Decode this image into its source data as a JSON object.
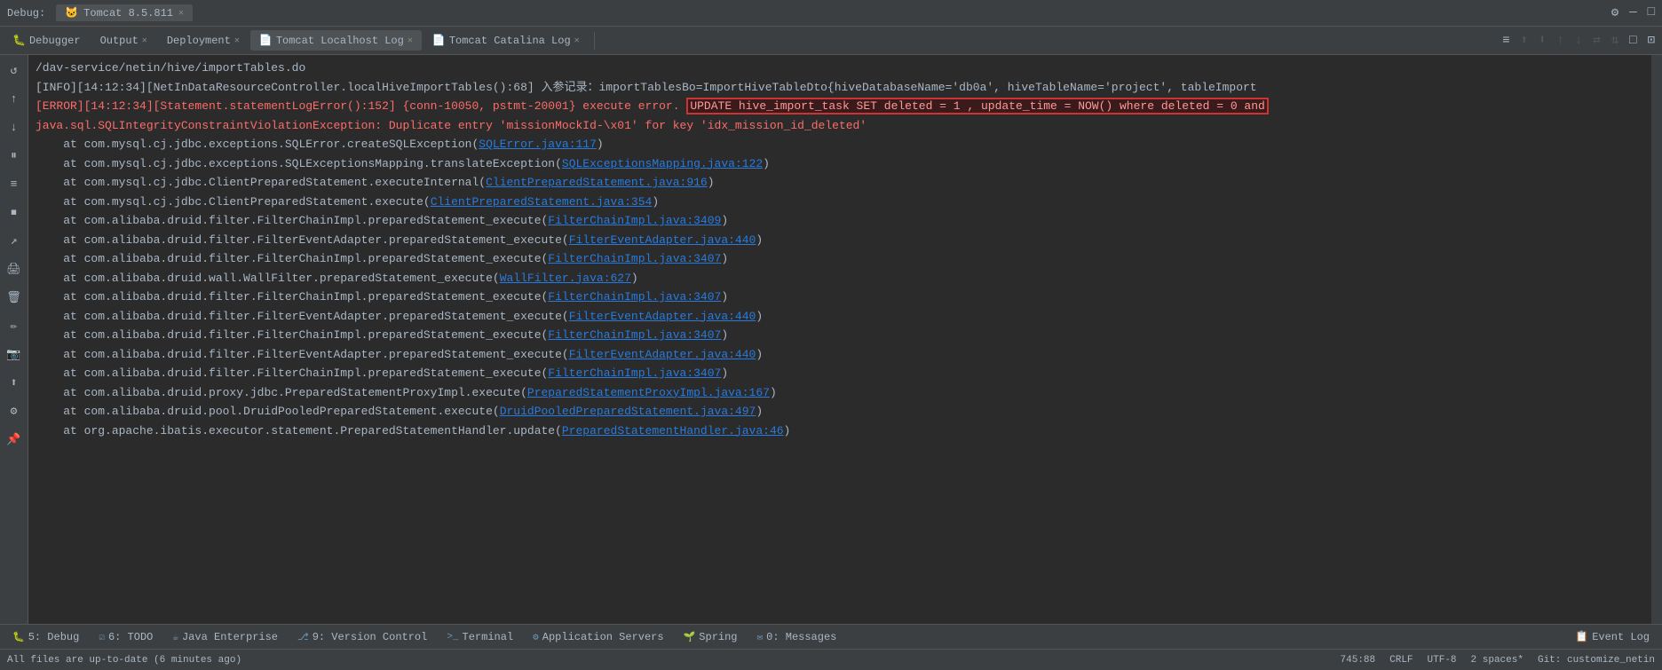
{
  "titleBar": {
    "debugLabel": "Debug:",
    "tomcatTab": "Tomcat 8.5.811",
    "settingsIcon": "⚙",
    "minIcon": "—",
    "maxIcon": "□"
  },
  "toolbar": {
    "tabs": [
      {
        "label": "Debugger",
        "icon": "🐛",
        "active": false,
        "closable": false
      },
      {
        "label": "Output",
        "icon": "",
        "active": false,
        "closable": false
      },
      {
        "label": "Deployment",
        "icon": "",
        "active": false,
        "closable": false
      },
      {
        "label": "Tomcat Localhost Log",
        "icon": "",
        "active": false,
        "closable": true
      },
      {
        "label": "Tomcat Catalina Log",
        "icon": "",
        "active": false,
        "closable": true
      }
    ],
    "icons": [
      "≡",
      "↑",
      "↓",
      "↑",
      "↓",
      "⇄",
      "⇅",
      "□",
      "⊡"
    ]
  },
  "sidebarIcons": [
    "↺",
    "↑",
    "↓",
    "⏸",
    "≡",
    "⏹",
    "↗",
    "🖨",
    "🗑",
    "✏",
    "📷",
    "⬆",
    "⚙",
    "📌"
  ],
  "logLines": [
    {
      "type": "path",
      "text": "/dav-service/netin/hive/importTables.do"
    },
    {
      "type": "info",
      "text": "[INFO][14:12:34][NetInDataResourceController.localHiveImportTables():68] 入参记录：importTablesBo=ImportHiveTableDto{hiveDatabaseName='db0a', hiveTableName='project', tableImport"
    },
    {
      "type": "error_highlight",
      "text": "[ERROR][14:12:34][Statement.statementLogError():152] {conn-10050, pstmt-20001} execute error.",
      "highlight": "UPDATE hive_import_task SET deleted = 1 , update_time = NOW() where deleted = 0 and"
    },
    {
      "type": "error",
      "text": "java.sql.SQLIntegrityConstraintViolationException: Duplicate entry 'missionMockId-\\x01' for key 'idx_mission_id_deleted'"
    },
    {
      "type": "stack",
      "text": "    at com.mysql.cj.jdbc.exceptions.SQLError.createSQLException(SQLError.java:117)"
    },
    {
      "type": "stack",
      "text": "    at com.mysql.cj.jdbc.exceptions.SQLExceptionsMapping.translateException(SQLExceptionsMapping.java:122)"
    },
    {
      "type": "stack",
      "text": "    at com.mysql.cj.jdbc.ClientPreparedStatement.executeInternal(ClientPreparedStatement.java:916)"
    },
    {
      "type": "stack",
      "text": "    at com.mysql.cj.jdbc.ClientPreparedStatement.execute(ClientPreparedStatement.java:354)"
    },
    {
      "type": "stack",
      "text": "    at com.alibaba.druid.filter.FilterChainImpl.preparedStatement_execute(FilterChainImpl.java:3409)"
    },
    {
      "type": "stack",
      "text": "    at com.alibaba.druid.filter.FilterEventAdapter.preparedStatement_execute(FilterEventAdapter.java:440)"
    },
    {
      "type": "stack",
      "text": "    at com.alibaba.druid.filter.FilterChainImpl.preparedStatement_execute(FilterChainImpl.java:3407)"
    },
    {
      "type": "stack",
      "text": "    at com.alibaba.druid.wall.WallFilter.preparedStatement_execute(WallFilter.java:627)"
    },
    {
      "type": "stack",
      "text": "    at com.alibaba.druid.filter.FilterChainImpl.preparedStatement_execute(FilterChainImpl.java:3407)"
    },
    {
      "type": "stack",
      "text": "    at com.alibaba.druid.filter.FilterEventAdapter.preparedStatement_execute(FilterEventAdapter.java:440)"
    },
    {
      "type": "stack",
      "text": "    at com.alibaba.druid.filter.FilterChainImpl.preparedStatement_execute(FilterChainImpl.java:3407)"
    },
    {
      "type": "stack",
      "text": "    at com.alibaba.druid.filter.FilterEventAdapter.preparedStatement_execute(FilterEventAdapter.java:440)"
    },
    {
      "type": "stack",
      "text": "    at com.alibaba.druid.filter.FilterChainImpl.preparedStatement_execute(FilterChainImpl.java:3407)"
    },
    {
      "type": "stack",
      "text": "    at com.alibaba.druid.proxy.jdbc.PreparedStatementProxyImpl.execute(PreparedStatementProxyImpl.java:167)"
    },
    {
      "type": "stack",
      "text": "    at com.alibaba.druid.pool.DruidPooledPreparedStatement.execute(DruidPooledPreparedStatement.java:497)"
    },
    {
      "type": "stack",
      "text": "    at org.apache.ibatis.executor.statement.PreparedStatementHandler.update(PreparedStatementHandler.java:46)"
    }
  ],
  "highlightedSQL": "UPDATE hive_import_task SET deleted = 1 , update_time = NOW() where deleted = 0 and",
  "highlightedSQLEnd": "and",
  "statusBar": {
    "message": "All files are up-to-date (6 minutes ago)",
    "position": "745:88",
    "lineEnding": "CRLF",
    "encoding": "UTF-8",
    "indentation": "2 spaces*",
    "vcs": "Git: customize_netin"
  },
  "bottomTabs": [
    {
      "label": "5: Debug",
      "icon": "🐛",
      "active": false
    },
    {
      "label": "6: TODO",
      "icon": "☑",
      "active": false
    },
    {
      "label": "Java Enterprise",
      "icon": "☕",
      "active": false
    },
    {
      "label": "9: Version Control",
      "icon": "⎇",
      "active": false
    },
    {
      "label": "Terminal",
      "icon": ">_",
      "active": false
    },
    {
      "label": "Application Servers",
      "icon": "⚙",
      "active": false
    },
    {
      "label": "Spring",
      "icon": "🌱",
      "active": false
    },
    {
      "label": "0: Messages",
      "icon": "✉",
      "active": false
    }
  ],
  "eventLogTab": "Event Log",
  "links": {
    "SQLError": "SQLError.java:117",
    "SQLExceptionsMapping": "SQLExceptionsMapping.java:122",
    "ClientPreparedStatement916": "ClientPreparedStatement.java:916",
    "ClientPreparedStatement354": "ClientPreparedStatement.java:354",
    "FilterChainImpl3409": "FilterChainImpl.java:3409",
    "FilterEventAdapter440a": "FilterEventAdapter.java:440",
    "FilterChainImpl3407a": "FilterChainImpl.java:3407",
    "WallFilter627": "WallFilter.java:627",
    "FilterChainImpl3407b": "FilterChainImpl.java:3407",
    "FilterEventAdapter440b": "FilterEventAdapter.java:440",
    "FilterChainImpl3407c": "FilterChainImpl.java:3407",
    "FilterEventAdapter440c": "FilterEventAdapter.java:440",
    "FilterChainImpl3407d": "FilterChainImpl.java:3407",
    "PreparedStatementProxyImpl167": "PreparedStatementProxyImpl.java:167",
    "DruidPooledPreparedStatement497": "DruidPooledPreparedStatement.java:497",
    "PreparedStatementHandler46": "PreparedStatementHandler.java:46"
  }
}
